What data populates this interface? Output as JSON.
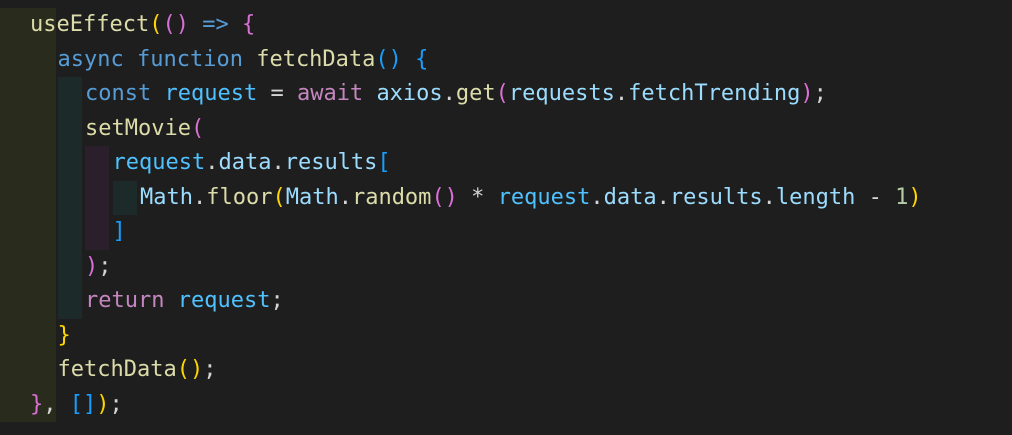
{
  "theme": {
    "background": "#1e1e1e",
    "default_text": "#d4d4d4",
    "keyword_blue": "#569cd6",
    "keyword_purple": "#c586c0",
    "function_yellow": "#dcdcaa",
    "variable_blue": "#9cdcfe",
    "object_blue": "#4fc1ff",
    "number_green": "#b5cea8",
    "bracket_gold": "#ffd700",
    "bracket_orchid": "#da70d6",
    "bracket_blue": "#179fff",
    "indent_guide_colors": [
      "#292b1c",
      "#1c2b29",
      "#2b1f2b",
      "#1c2b29",
      "#3a3a2a"
    ]
  },
  "code_lines": [
    {
      "id": "line-1",
      "tokens": [
        {
          "text": "useEffect",
          "cls": "fn"
        },
        {
          "text": "(",
          "cls": "b1"
        },
        {
          "text": "()",
          "cls": "b2"
        },
        {
          "text": " ",
          "cls": "op"
        },
        {
          "text": "=>",
          "cls": "kw-blue"
        },
        {
          "text": " ",
          "cls": "op"
        },
        {
          "text": "{",
          "cls": "b2"
        }
      ]
    },
    {
      "id": "line-2",
      "tokens": [
        {
          "text": "async",
          "cls": "kw-blue"
        },
        {
          "text": " ",
          "cls": "op"
        },
        {
          "text": "function",
          "cls": "kw-blue"
        },
        {
          "text": " ",
          "cls": "op"
        },
        {
          "text": "fetchData",
          "cls": "fn"
        },
        {
          "text": "()",
          "cls": "b3"
        },
        {
          "text": " ",
          "cls": "op"
        },
        {
          "text": "{",
          "cls": "b3"
        }
      ]
    },
    {
      "id": "line-3",
      "tokens": [
        {
          "text": "const",
          "cls": "kw-blue"
        },
        {
          "text": " ",
          "cls": "op"
        },
        {
          "text": "request",
          "cls": "obj"
        },
        {
          "text": " = ",
          "cls": "op"
        },
        {
          "text": "await",
          "cls": "kw-purple"
        },
        {
          "text": " ",
          "cls": "op"
        },
        {
          "text": "axios",
          "cls": "var"
        },
        {
          "text": ".",
          "cls": "op"
        },
        {
          "text": "get",
          "cls": "fn"
        },
        {
          "text": "(",
          "cls": "b2"
        },
        {
          "text": "requests",
          "cls": "var"
        },
        {
          "text": ".",
          "cls": "op"
        },
        {
          "text": "fetchTrending",
          "cls": "var"
        },
        {
          "text": ")",
          "cls": "b2"
        },
        {
          "text": ";",
          "cls": "op"
        }
      ]
    },
    {
      "id": "line-4",
      "tokens": [
        {
          "text": "setMovie",
          "cls": "fn"
        },
        {
          "text": "(",
          "cls": "b2"
        }
      ]
    },
    {
      "id": "line-5",
      "tokens": [
        {
          "text": "request",
          "cls": "obj"
        },
        {
          "text": ".",
          "cls": "op"
        },
        {
          "text": "data",
          "cls": "var"
        },
        {
          "text": ".",
          "cls": "op"
        },
        {
          "text": "results",
          "cls": "var"
        },
        {
          "text": "[",
          "cls": "b3"
        }
      ]
    },
    {
      "id": "line-6",
      "tokens": [
        {
          "text": "Math",
          "cls": "var"
        },
        {
          "text": ".",
          "cls": "op"
        },
        {
          "text": "floor",
          "cls": "fn"
        },
        {
          "text": "(",
          "cls": "b1"
        },
        {
          "text": "Math",
          "cls": "var"
        },
        {
          "text": ".",
          "cls": "op"
        },
        {
          "text": "random",
          "cls": "fn"
        },
        {
          "text": "()",
          "cls": "b2"
        },
        {
          "text": " * ",
          "cls": "op"
        },
        {
          "text": "request",
          "cls": "obj"
        },
        {
          "text": ".",
          "cls": "op"
        },
        {
          "text": "data",
          "cls": "var"
        },
        {
          "text": ".",
          "cls": "op"
        },
        {
          "text": "results",
          "cls": "var"
        },
        {
          "text": ".",
          "cls": "op"
        },
        {
          "text": "length",
          "cls": "var"
        },
        {
          "text": " - ",
          "cls": "op"
        },
        {
          "text": "1",
          "cls": "num"
        },
        {
          "text": ")",
          "cls": "b1"
        }
      ]
    },
    {
      "id": "line-7",
      "tokens": [
        {
          "text": "]",
          "cls": "b3"
        }
      ]
    },
    {
      "id": "line-8",
      "tokens": [
        {
          "text": ")",
          "cls": "b2"
        },
        {
          "text": ";",
          "cls": "op"
        }
      ]
    },
    {
      "id": "line-9",
      "tokens": [
        {
          "text": "return",
          "cls": "kw-purple"
        },
        {
          "text": " ",
          "cls": "op"
        },
        {
          "text": "request",
          "cls": "obj"
        },
        {
          "text": ";",
          "cls": "op"
        }
      ]
    },
    {
      "id": "line-10",
      "tokens": [
        {
          "text": "}",
          "cls": "b1"
        }
      ]
    },
    {
      "id": "line-11",
      "tokens": [
        {
          "text": "fetchData",
          "cls": "fn"
        },
        {
          "text": "()",
          "cls": "b1"
        },
        {
          "text": ";",
          "cls": "op"
        }
      ]
    },
    {
      "id": "line-12",
      "tokens": [
        {
          "text": "}",
          "cls": "b2"
        },
        {
          "text": ", ",
          "cls": "op"
        },
        {
          "text": "[]",
          "cls": "b3"
        },
        {
          "text": ")",
          "cls": "b1"
        },
        {
          "text": ";",
          "cls": "op"
        }
      ]
    }
  ]
}
